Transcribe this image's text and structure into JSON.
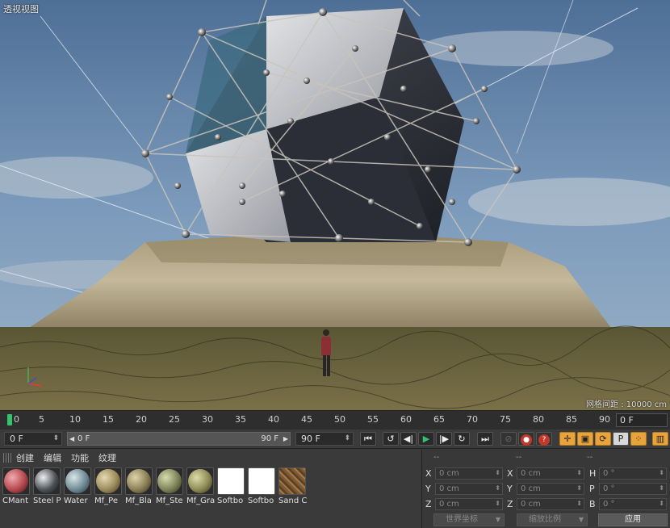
{
  "viewport": {
    "title": "透视视图",
    "grid_spacing_label": "网格间距 : 10000 cm"
  },
  "timeline": {
    "ticks": [
      "0",
      "5",
      "10",
      "15",
      "20",
      "25",
      "30",
      "35",
      "40",
      "45",
      "50",
      "55",
      "60",
      "65",
      "70",
      "75",
      "80",
      "85",
      "90"
    ],
    "current_frame": "0 F"
  },
  "transport": {
    "start_frame": "0 F",
    "range_start": "0 F",
    "range_end": "90 F",
    "end_frame": "90 F",
    "buttons": {
      "go_start": "⏮",
      "prev_key": "↺",
      "step_back": "◀|",
      "play": "▶",
      "step_forward": "|▶",
      "next_key": "↻",
      "go_end": "⏭",
      "record_lock": "⊘",
      "record": "●",
      "auto_key": "?",
      "move": "✛",
      "scale": "▣",
      "rotate": "⟳",
      "param": "P",
      "grid": "⁘",
      "film": "▥"
    }
  },
  "material_manager": {
    "menu": [
      "创建",
      "编辑",
      "功能",
      "纹理"
    ],
    "materials": [
      {
        "name": "CMant",
        "color": "#b5484d"
      },
      {
        "name": "Steel P",
        "color": "#4e5358"
      },
      {
        "name": "Water",
        "color": "#6f8a95"
      },
      {
        "name": "Mf_Pe",
        "color": "#9c8a5c"
      },
      {
        "name": "Mf_Bla",
        "color": "#8b7f56"
      },
      {
        "name": "Mf_Ste",
        "color": "#7d8258"
      },
      {
        "name": "Mf_Gra",
        "color": "#8c8a55"
      },
      {
        "name": "Softbo",
        "color": "#ffffff"
      },
      {
        "name": "Softbo",
        "color": "#ffffff"
      },
      {
        "name": "Sand C",
        "color": "#7d5a33"
      }
    ]
  },
  "coordinates": {
    "headers": [
      "--",
      "--",
      "--"
    ],
    "rows": [
      {
        "pos_label": "X",
        "pos_value": "0 cm",
        "size_label": "X",
        "size_value": "0 cm",
        "rot_label": "H",
        "rot_value": "0 °"
      },
      {
        "pos_label": "Y",
        "pos_value": "0 cm",
        "size_label": "Y",
        "size_value": "0 cm",
        "rot_label": "P",
        "rot_value": "0 °"
      },
      {
        "pos_label": "Z",
        "pos_value": "0 cm",
        "size_label": "Z",
        "size_value": "0 cm",
        "rot_label": "B",
        "rot_value": "0 °"
      }
    ],
    "coord_system": "世界坐标",
    "scale_mode": "缩放比例",
    "apply_label": "应用"
  },
  "colors": {
    "playhead": "#31c46b",
    "record": "#c0392b",
    "active_tool": "#e8a33d"
  }
}
